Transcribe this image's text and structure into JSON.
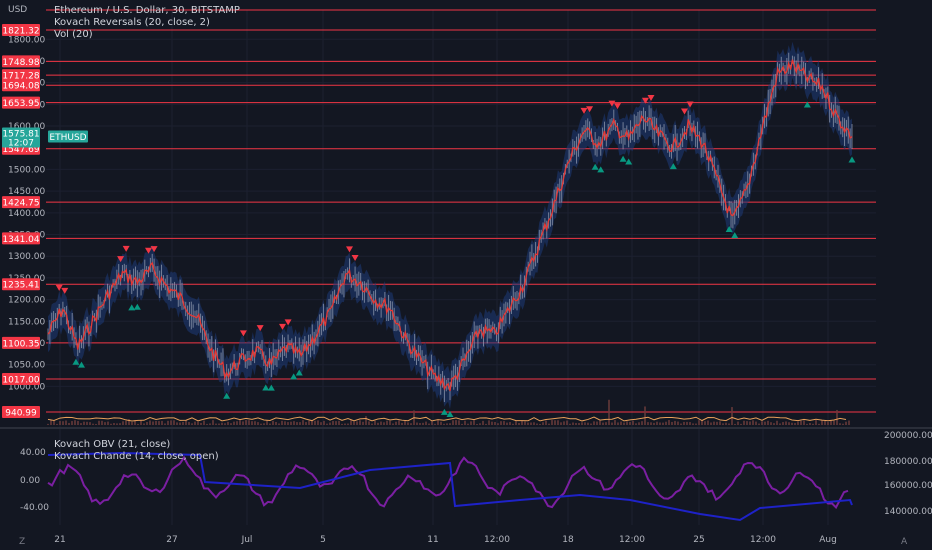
{
  "header": {
    "currency": "USD",
    "title": "Ethereum / U.S. Dollar, 30, BITSTAMP",
    "indicators": [
      "Kovach Reversals (20, close, 2)",
      "Vol (20)"
    ]
  },
  "lower_pane": {
    "indicators": [
      "Kovach OBV (21, close)",
      "Kovach Chande (14, close, open)"
    ]
  },
  "symbol_tag": "ETHUSD",
  "price_tag": {
    "price": "1575.81",
    "countdown": "12:07"
  },
  "price_axis_ticks": [
    "1800.00",
    "1750.00",
    "1700.00",
    "1650.00",
    "1600.00",
    "1500.00",
    "1450.00",
    "1400.00",
    "1350.00",
    "1300.00",
    "1250.00",
    "1200.00",
    "1150.00",
    "1100.00",
    "1050.00",
    "1000.00"
  ],
  "level_labels": [
    "1821.32",
    "1748.98",
    "1717.28",
    "1694.08",
    "1653.95",
    "1547.69",
    "1424.75",
    "1341.04",
    "1235.41",
    "1100.35",
    "1017.00",
    "940.99"
  ],
  "lower_left_ticks": [
    "40.00",
    "0.00",
    "-40.00"
  ],
  "lower_right_ticks": [
    "200000.00",
    "180000.00",
    "160000.00",
    "140000.00"
  ],
  "time_ticks": [
    "21",
    "27",
    "Jul",
    "5",
    "11",
    "12:00",
    "18",
    "12:00",
    "25",
    "12:00",
    "Aug"
  ],
  "corner_left": "Z",
  "corner_right": "A",
  "colors": {
    "background": "#131722",
    "level_line": "#f23645",
    "price_tag": "#26a69a",
    "down_marker": "#f23645",
    "up_marker": "#089981",
    "chande": "#7b1fa2",
    "obv": "#1e22c8",
    "band": "#1e3a78"
  },
  "chart_data": {
    "type": "line",
    "symbol": "ETHUSD",
    "price_levels": [
      1821.32,
      1748.98,
      1717.28,
      1694.08,
      1653.95,
      1547.69,
      1424.75,
      1341.04,
      1235.41,
      1100.35,
      1017.0,
      940.99
    ],
    "current_price": 1575.81,
    "ylim": [
      940,
      1860
    ],
    "price_path": [
      1120,
      1180,
      1090,
      1150,
      1210,
      1260,
      1240,
      1270,
      1230,
      1200,
      1160,
      1080,
      1030,
      1060,
      1080,
      1050,
      1090,
      1070,
      1120,
      1170,
      1260,
      1240,
      1200,
      1180,
      1110,
      1060,
      1020,
      1000,
      1060,
      1130,
      1120,
      1180,
      1240,
      1330,
      1420,
      1520,
      1590,
      1560,
      1600,
      1570,
      1620,
      1580,
      1550,
      1600,
      1560,
      1470,
      1380,
      1460,
      1600,
      1720,
      1740,
      1710,
      1690,
      1620,
      1575.81
    ],
    "lower_pane": {
      "left_ylim": [
        -60,
        60
      ],
      "right_ylim": [
        125000,
        205000
      ]
    }
  }
}
